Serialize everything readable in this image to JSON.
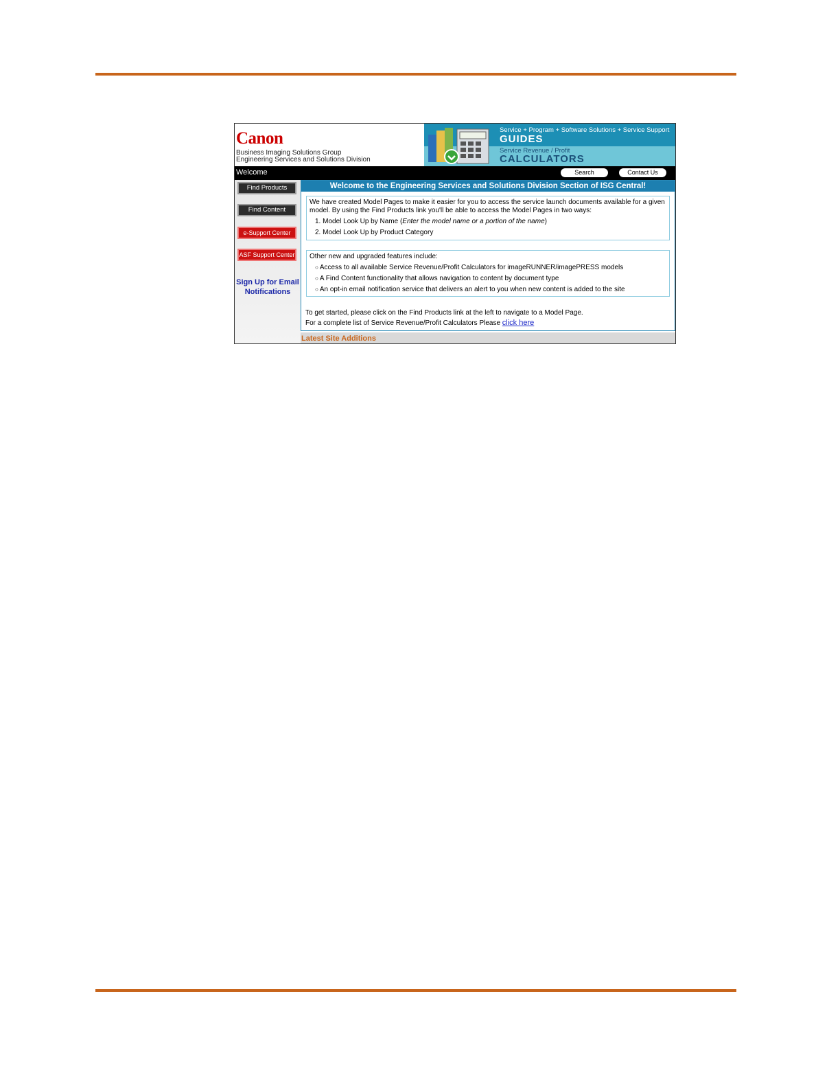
{
  "header": {
    "logo": "Canon",
    "line1": "Business Imaging Solutions Group",
    "line2": "Engineering Services and Solutions Division"
  },
  "banner": {
    "nav": "Service + Program + Software Solutions + Service Support",
    "guides": "GUIDES",
    "revenue": "Service Revenue / Profit",
    "calculators": "CALCULATORS"
  },
  "bar": {
    "welcome": "Welcome",
    "search_label": "Search",
    "contact_label": "Contact Us"
  },
  "sidebar": {
    "items": [
      {
        "label": "Find Products"
      },
      {
        "label": "Find Content"
      },
      {
        "label": "e-Support Center"
      },
      {
        "label": "ASF Support Center"
      }
    ],
    "signup_line1": "Sign Up for Email",
    "signup_line2": "Notifications"
  },
  "main": {
    "title": "Welcome to the Engineering Services and Solutions Division Section of ISG Central!",
    "intro": "We have created Model Pages to make it easier for you to access the service launch documents available for a given model. By using the Find Products link you'll be able to access the Model Pages in two ways:",
    "item1_prefix": "1. Model Look Up by Name (",
    "item1_italic": "Enter the model name or a portion of the name",
    "item1_suffix": ")",
    "item2": "2. Model Look Up by Product Category",
    "features_intro": "Other new and upgraded features include:",
    "features": [
      "Access to all available Service Revenue/Profit Calculators for imageRUNNER/imagePRESS models",
      "A Find Content functionality that allows navigation to content by document type",
      "An opt-in email notification service that delivers an alert to you when new content is added to the site"
    ],
    "get_started": "To get started, please click on the Find Products link at the left to navigate to a Model Page.",
    "complete_list": "For a complete list of Service Revenue/Profit Calculators Please ",
    "click_here": "click here"
  },
  "latest": "Latest Site Additions"
}
